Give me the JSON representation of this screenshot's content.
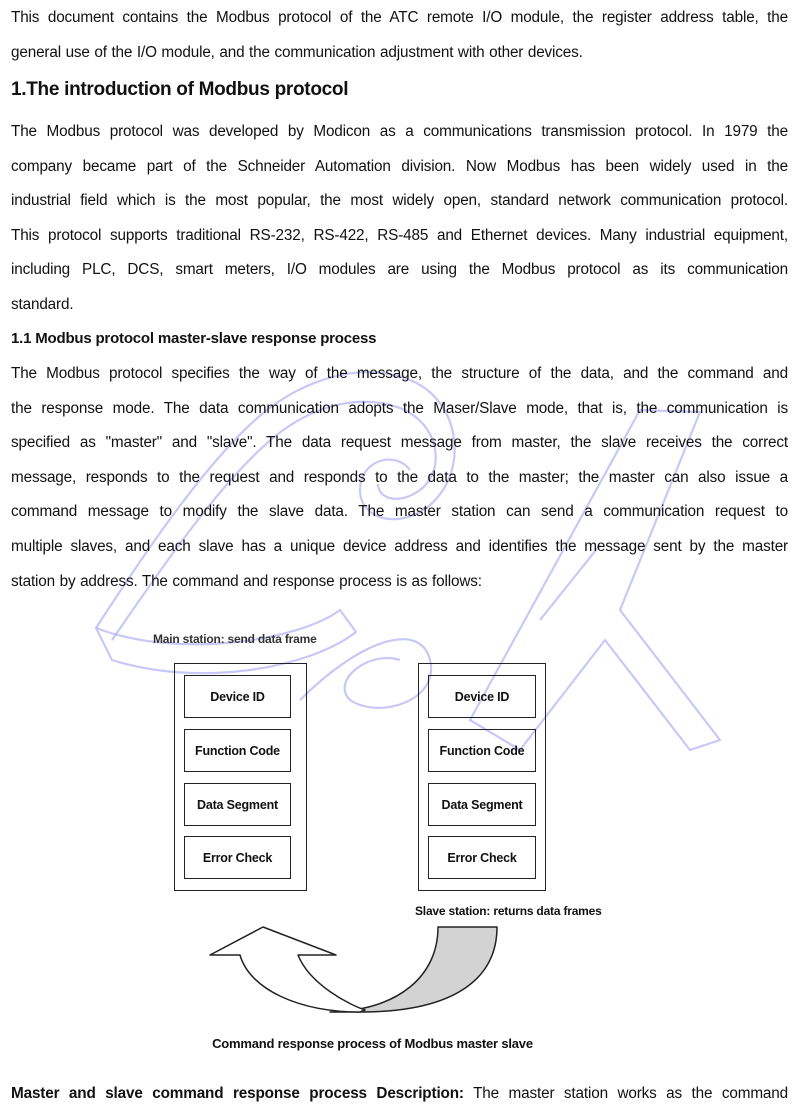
{
  "document": {
    "intro": {
      "lines": [
        "This document contains the Modbus protocol of the ATC remote I/O module, the register address table, the",
        "general use of the I/O module, and the communication adjustment with other devices."
      ]
    },
    "section1": {
      "heading": "1.The introduction of Modbus protocol",
      "lines": [
        "The Modbus protocol was developed by Modicon as a communications transmission protocol. In 1979 the",
        "company became part of the Schneider Automation division. Now Modbus has been widely used in the",
        "industrial field which is the most popular, the most widely open, standard network communication protocol.",
        "This protocol supports traditional RS-232, RS-422, RS-485 and Ethernet devices. Many industrial equipment,",
        "including PLC, DCS, smart meters, I/O modules are using the Modbus protocol as its communication",
        "standard."
      ]
    },
    "section1_1": {
      "heading": "1.1 Modbus protocol master-slave response process",
      "lines": [
        "The Modbus protocol specifies the way of the message, the structure of the data, and the command and",
        "the response mode. The data communication adopts the Maser/Slave mode, that is, the communication is",
        "specified as \"master\" and \"slave\". The data request message from master, the slave receives the correct",
        "message, responds to the request and responds to the data to the master; the master can also issue a",
        "command message to modify the slave data. The master station can send a communication request to",
        "multiple slaves, and each slave has a unique device address and identifies the message sent by the master",
        "station by address. The command and response process is as follows:"
      ]
    },
    "diagram": {
      "master_label": "Main station: send data frame",
      "slave_label": "Slave station: returns data frames",
      "master_fields": [
        "Device ID",
        "Function Code",
        "Data Segment",
        "Error Check"
      ],
      "slave_fields": [
        "Device ID",
        "Function Code",
        "Data Segment",
        "Error Check"
      ],
      "caption": "Command response process of Modbus master slave",
      "colors": {
        "response_arrow_fill": "#d3d3d3",
        "outline": "#222222"
      }
    },
    "description": {
      "bold_lead": "Master and slave command response process Description:",
      "text": " The master station works as the command"
    },
    "watermark": {
      "color": "#8c8cf0"
    }
  }
}
